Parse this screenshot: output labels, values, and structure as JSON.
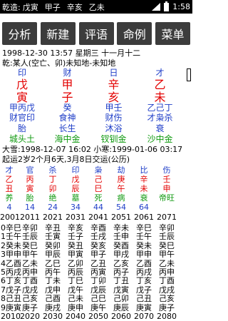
{
  "status_bar": {
    "label": "乾造:",
    "pillars": [
      "戊寅",
      "甲子",
      "辛亥",
      "乙未"
    ],
    "time": "1:58"
  },
  "toolbar": {
    "buttons": [
      "分析",
      "新建",
      "评语",
      "命例",
      "菜单"
    ]
  },
  "birth_line": "1998-12-30 13:57  星期三  十一月十二",
  "info_line": "乾:某人(空亡、卯)未知地-未知地",
  "chart": {
    "ten_gods": [
      "印",
      "财",
      "日",
      "才"
    ],
    "stems": [
      "戊",
      "甲",
      "辛",
      "乙"
    ],
    "branches": [
      "寅",
      "子",
      "亥",
      "未"
    ],
    "hidden_row1": [
      "甲丙戊",
      "癸",
      "甲壬",
      "乙己丁"
    ],
    "hidden_row2": [
      "财官印",
      "食神",
      "财伤",
      "才枭杀"
    ],
    "life_stage": [
      "胎",
      "长生",
      "沐浴",
      "衰"
    ],
    "nayin": [
      "城头土",
      "海中金",
      "钗钏金",
      "沙中金"
    ]
  },
  "jieqi_line": "大雪:1998-12-07 16:02  小寒:1999-01-06 03:17",
  "qiyun_line": "起运2岁2个月6天,3月8日交运(公历)",
  "dayun": {
    "ten_gods": [
      "才",
      "官",
      "杀",
      "印",
      "枭",
      "劫",
      "比",
      "伤"
    ],
    "stems": [
      "乙",
      "丙",
      "丁",
      "戊",
      "己",
      "庚",
      "辛",
      "壬"
    ],
    "branches": [
      "丑",
      "寅",
      "卯",
      "辰",
      "巳",
      "午",
      "未",
      "申"
    ],
    "stages": [
      "养",
      "胎",
      "绝",
      "墓",
      "死",
      "病",
      "衰",
      "帝旺"
    ],
    "ages": [
      "4",
      "14",
      "24",
      "34",
      "44",
      "54",
      "64",
      ""
    ],
    "years": [
      "2001",
      "2011",
      "2021",
      "2031",
      "2041",
      "2051",
      "2061",
      "2071"
    ]
  },
  "liunian_rows": [
    [
      "0辛巳",
      "辛卯",
      "辛丑",
      "辛亥",
      "辛酉",
      "辛未",
      "辛巳",
      "辛卯"
    ],
    [
      "1壬午",
      "壬辰",
      "壬寅",
      "壬子",
      "壬戌",
      "壬申",
      "壬午",
      "壬辰"
    ],
    [
      "2癸未",
      "癸巳",
      "癸卯",
      "癸丑",
      "癸亥",
      "癸酉",
      "癸未",
      "癸巳"
    ],
    [
      "3甲申",
      "甲午",
      "甲辰",
      "甲寅",
      "甲子",
      "甲戌",
      "甲申",
      "甲午"
    ],
    [
      "4乙酉",
      "乙未",
      "乙巳",
      "乙卯",
      "乙丑",
      "乙亥",
      "乙酉",
      "乙未"
    ],
    [
      "5丙戌",
      "丙申",
      "丙午",
      "丙辰",
      "丙寅",
      "丙子",
      "丙戌",
      "丙申"
    ],
    [
      "6丁亥",
      "丁酉",
      "丁未",
      "丁巳",
      "丁卯",
      "丁丑",
      "丁亥",
      "丁酉"
    ],
    [
      "7戊子",
      "戊戌",
      "戊申",
      "戊午",
      "戊辰",
      "戊寅",
      "戊子",
      "戊戌"
    ],
    [
      "8己丑",
      "己亥",
      "己酉",
      "己未",
      "己巳",
      "己卯",
      "己丑",
      "己亥"
    ],
    [
      "9庚寅",
      "庚子",
      "庚戌",
      "庚申",
      "庚午",
      "庚辰",
      "庚寅",
      "庚子"
    ],
    [
      "2010",
      "2020",
      "2030",
      "2040",
      "2050",
      "2060",
      "2070",
      "2080"
    ]
  ]
}
